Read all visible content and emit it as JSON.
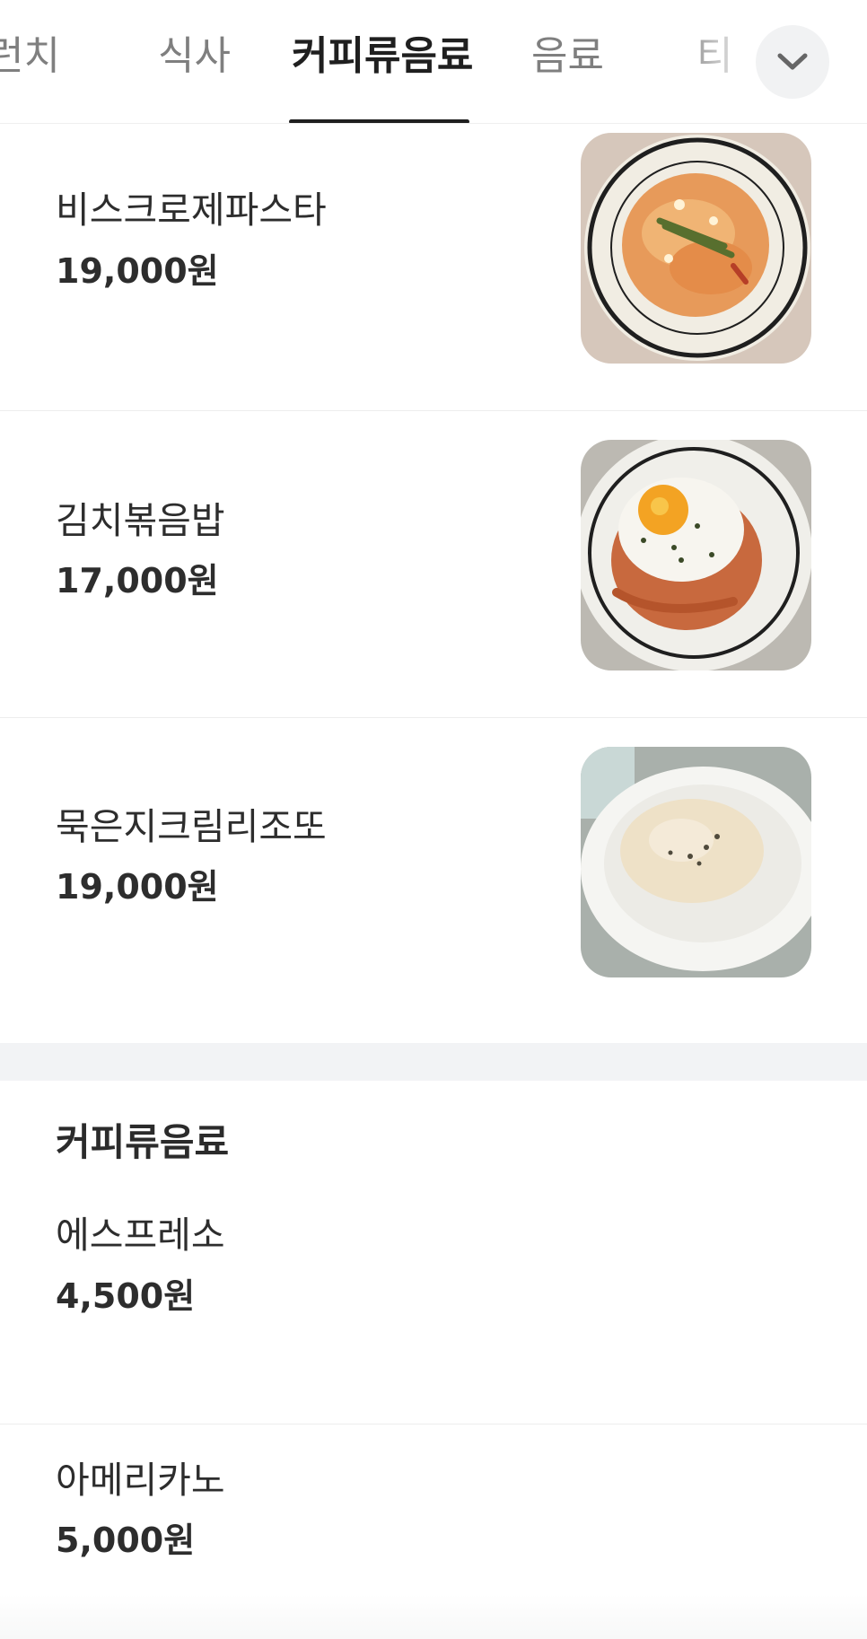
{
  "tabs": {
    "items": [
      {
        "label": "브런치",
        "visible_label": "런치"
      },
      {
        "label": "식사"
      },
      {
        "label": "커피류음료",
        "active": true
      },
      {
        "label": "음료"
      },
      {
        "label": "티"
      }
    ],
    "expand_icon": "chevron-down-icon"
  },
  "menu": {
    "meal_items": [
      {
        "name": "비스크로제파스타",
        "price": "19,000원",
        "photo": "pasta-photo"
      },
      {
        "name": "김치볶음밥",
        "price": "17,000원",
        "photo": "fried-rice-photo"
      },
      {
        "name": "묵은지크림리조또",
        "price": "19,000원",
        "photo": "risotto-photo"
      }
    ],
    "coffee_section": {
      "title": "커피류음료",
      "items": [
        {
          "name": "에스프레소",
          "price": "4,500원"
        },
        {
          "name": "아메리카노",
          "price": "5,000원"
        }
      ]
    }
  },
  "colors": {
    "active_tab": "#1f1f1f",
    "inactive_tab": "#7f7f7f",
    "divider": "#ededed",
    "section_gap": "#f2f3f5"
  }
}
